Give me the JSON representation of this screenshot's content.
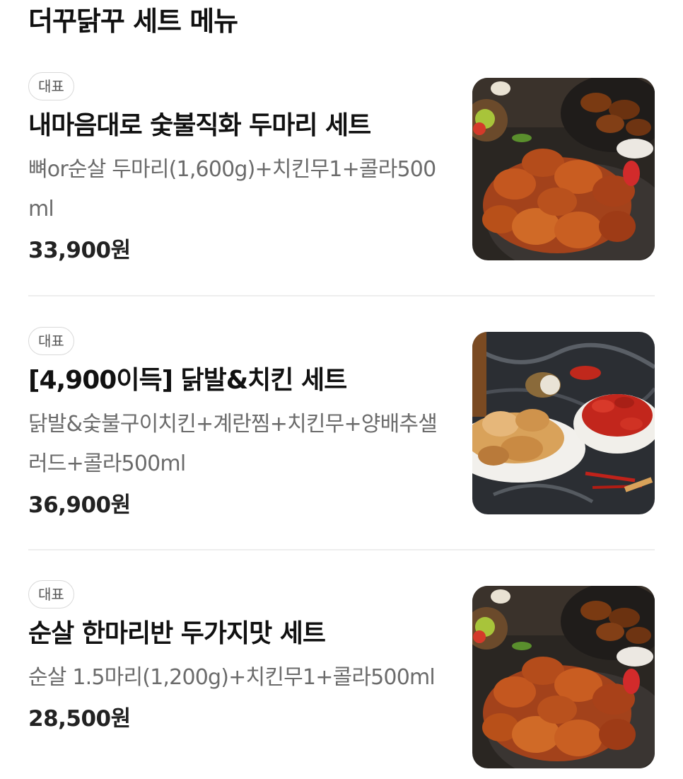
{
  "section_title": "더꾸닭꾸 세트 메뉴",
  "items": [
    {
      "badge": "대표",
      "name": "내마음대로 숯불직화 두마리 세트",
      "description": "뼈or순살 두마리(1,600g)+치킨무1+콜라500ml",
      "price": "33,900원",
      "photo": "chicken-platter"
    },
    {
      "badge": "대표",
      "name": "[4,900이득] 닭발&치킨 세트",
      "description": "닭발&숯불구이치킨+계란찜+치킨무+양배추샐러드+콜라500ml",
      "price": "36,900원",
      "photo": "chicken-feet-and-chicken"
    },
    {
      "badge": "대표",
      "name": "순살 한마리반 두가지맛 세트",
      "description": "순살 1.5마리(1,200g)+치킨무1+콜라500ml",
      "price": "28,500원",
      "photo": "chicken-platter"
    }
  ]
}
